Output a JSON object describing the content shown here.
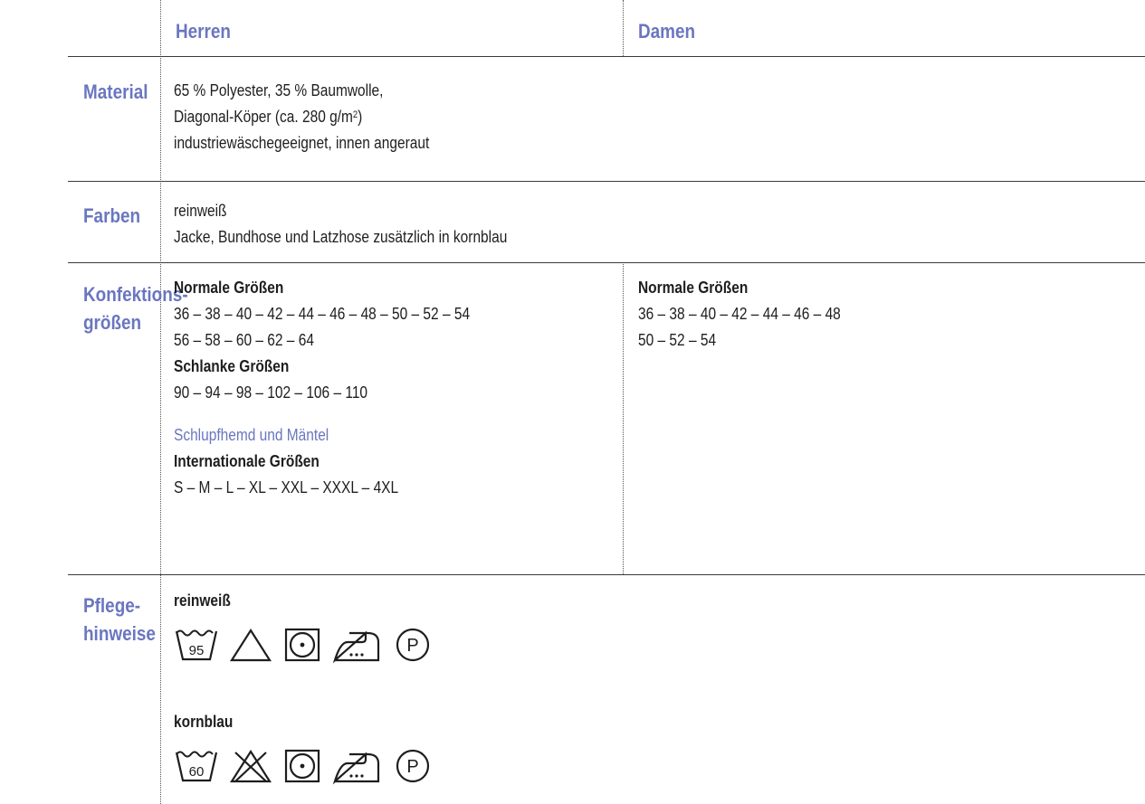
{
  "columns": {
    "herren": "Herren",
    "damen": "Damen"
  },
  "rows": {
    "material": {
      "label": "Material",
      "lines": [
        "65 % Polyester, 35 % Baumwolle,",
        "Diagonal-Köper   (ca. 280 g/m",
        "2",
        ")",
        "industriewäschegeeignet, innen angeraut"
      ]
    },
    "farben": {
      "label": "Farben",
      "lines": [
        "reinweiß",
        "Jacke, Bundhose und Latzhose zusätzlich in kornblau"
      ]
    },
    "groessen": {
      "label_line1": "Konfektions-",
      "label_line2": "größen",
      "herren": {
        "normal_title": "Normale Größen",
        "normal_line1": "36 – 38 – 40 – 42 – 44 – 46 – 48 – 50 – 52 – 54",
        "normal_line2": "56 – 58 – 60 – 62 – 64",
        "schlank_title": "Schlanke Größen",
        "schlank_line": "90 – 94 – 98 – 102 – 106 – 110",
        "schlupf_title": "Schlupfhemd und Mäntel",
        "intl_title": "Internationale Größen",
        "intl_line": "S – M – L – XL – XXL – XXXL – 4XL"
      },
      "damen": {
        "normal_title": "Normale Größen",
        "normal_line1": "36 – 38 – 40 – 42 – 44 – 46 – 48",
        "normal_line2": "50 – 52 – 54"
      }
    },
    "pflege": {
      "label_line1": "Pflege-",
      "label_line2": "hinweise",
      "reinweiss": {
        "title": "reinweiß",
        "wash_temp": "95",
        "icons": [
          "wash-95-icon",
          "bleach-allowed-icon",
          "tumble-dry-icon",
          "iron-icon",
          "dry-clean-p-icon"
        ]
      },
      "kornblau": {
        "title": "kornblau",
        "wash_temp": "60",
        "icons": [
          "wash-60-icon",
          "no-bleach-icon",
          "tumble-dry-icon",
          "iron-icon",
          "dry-clean-p-icon"
        ]
      },
      "dry_clean_letter": "P"
    }
  },
  "colors": {
    "accent": "#6a76c0",
    "text": "#1e1e1e",
    "rule": "#3a3a3a"
  }
}
